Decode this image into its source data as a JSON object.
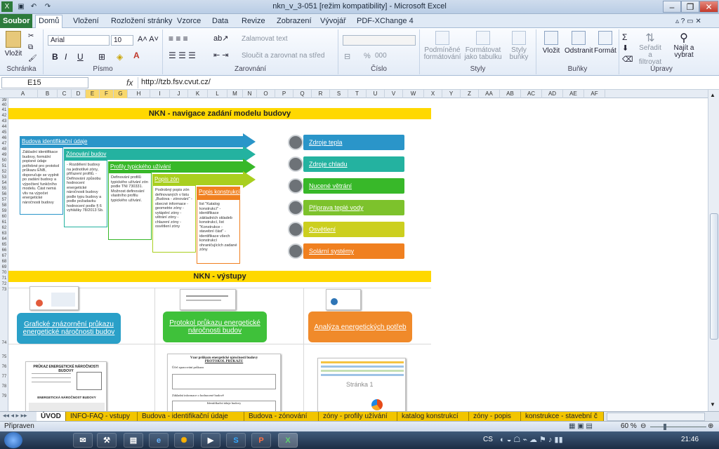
{
  "window": {
    "title": "nkn_v_3-051  [režim kompatibility]  -  Microsoft Excel"
  },
  "ribbon_tabs": [
    "Soubor",
    "Domů",
    "Vložení",
    "Rozložení stránky",
    "Vzorce",
    "Data",
    "Revize",
    "Zobrazení",
    "Vývojář",
    "PDF-XChange 4"
  ],
  "ribbon": {
    "clipboard": {
      "paste": "Vložit",
      "label": "Schránka"
    },
    "font": {
      "name": "Arial",
      "size": "10",
      "bold": "B",
      "italic": "I",
      "underline": "U",
      "label": "Písmo"
    },
    "alignment": {
      "wrap": "Zalamovat text",
      "merge": "Sloučit a zarovnat na střed",
      "label": "Zarovnání"
    },
    "number": {
      "percent": "%",
      "thousands": "000",
      "label": "Číslo"
    },
    "styles": {
      "conditional": "Podmíněné formátování",
      "table": "Formátovat jako tabulku",
      "cell_styles": "Styly buňky",
      "label": "Styly"
    },
    "cells": {
      "insert": "Vložit",
      "delete": "Odstranit",
      "format": "Formát",
      "label": "Buňky"
    },
    "editing": {
      "sort": "Seřadit a filtrovat",
      "find": "Najít a vybrat",
      "label": "Úpravy"
    }
  },
  "namebox": "E15",
  "fx": "fx",
  "formula": "http://tzb.fsv.cvut.cz/",
  "columns": [
    "A",
    "B",
    "C",
    "D",
    "E",
    "F",
    "G",
    "H",
    "I",
    "J",
    "K",
    "L",
    "M",
    "N",
    "O",
    "P",
    "Q",
    "R",
    "S",
    "T",
    "U",
    "V",
    "W",
    "X",
    "Y",
    "Z",
    "AA",
    "AB",
    "AC",
    "AD",
    "AE",
    "AF"
  ],
  "rows": [
    "39",
    "40",
    "41",
    "42",
    "43",
    "44",
    "45",
    "46",
    "47",
    "48",
    "49",
    "50",
    "51",
    "52",
    "53",
    "54",
    "55",
    "56",
    "57",
    "58",
    "59",
    "60",
    "61",
    "62",
    "63",
    "64",
    "65",
    "66",
    "67",
    "68",
    "69",
    "70",
    "71",
    "72",
    "73",
    "74",
    "75",
    "76",
    "77",
    "78",
    "79"
  ],
  "sheet": {
    "band1": "NKN - navigace zadání modelu budovy",
    "band2": "NKN - výstupy",
    "steps": [
      {
        "label": "Budova identifikační údaje",
        "color": "#2a95c9",
        "desc": "Základní identifikace budovy, formální popisné údaje potřebné pro protokol průkazu ENB, doporučuje se vyplnit po zadání budovy a výpočtení funkčního modelu. Část nemá vliv na výpočet energetické náročnosti budovy"
      },
      {
        "label": "Zónování budov",
        "color": "#24b2a0",
        "desc": "- Rozdělení budovy na jednotlivé zóny, přiřazení profilů. - Definování způsobu hodnocení energetické náročnosti budovy podle typu budovy a podle požadavku hodnocení podle § 6 vyhlášky 78/2013 Sb."
      },
      {
        "label": "Profily typického užívání",
        "color": "#38b829",
        "desc": "Definování profilů typického užívání zón podle TNI 730331. Možnost definování vlastního profilu typického užívání."
      },
      {
        "label": "Popis zón",
        "color": "#a9cf1f",
        "desc": "Podrobný popis zón definovaných v listu „Budova - zónování“ - obecné informace - geometrie zóny - vytápění zóny - větrání zóny - chlazení zóny - osvětlení zóny"
      },
      {
        "label": "Popis konstrukcí",
        "color": "#f08020",
        "desc": "list \"Katalog konstrukcí\" - identifikace základních skladeb konstrukcí, list \"Konstrukce - stavební část\" - identifikace všech konstrukcí ohraničujících zadané zóny"
      }
    ],
    "nav_buttons": [
      {
        "label": "Zdroje tepla",
        "color": "#2a95c9",
        "icon": "thermometer-icon"
      },
      {
        "label": "Zdroje chladu",
        "color": "#24b2a0",
        "icon": "cold-thermometer-icon"
      },
      {
        "label": "Nucené větrání",
        "color": "#38b829",
        "icon": "fan-icon"
      },
      {
        "label": "Příprava teplé vody",
        "color": "#7dc22c",
        "icon": "tap-icon"
      },
      {
        "label": "Osvětlení",
        "color": "#cccf1f",
        "icon": "bulb-icon"
      },
      {
        "label": "Solární systémy",
        "color": "#f08020",
        "icon": "sun-icon"
      }
    ],
    "outputs": [
      {
        "label": "Grafické znázornění průkazu energetické náročnosti budov",
        "color": "#2aa0c8"
      },
      {
        "label": "Protokol průkazu energetické náročnosti budov",
        "color": "#3fc13a"
      },
      {
        "label": "Analýza energetických potřeb",
        "color": "#f08a2a"
      }
    ],
    "thumb_texts": {
      "pruk_title": "PRŮKAZ ENERGETICKÉ NÁROČNOSTI BUDOVY",
      "pruk_sub": "ENERGETICKÁ NÁROČNOST BUDOVY",
      "proto_title": "Vzor průkazu energetické náročnosti budovy",
      "proto_sub": "PROTOKOL PRŮKAZU",
      "proto_sec": "Účel zpracování průkazu",
      "proto_sec2": "Základní informace o hodnocené budově",
      "proto_sec3": "Identifikační údaje budovy",
      "stranka": "Stránka 1"
    }
  },
  "sheet_tabs": [
    "ÚVOD",
    "INFO-FAQ - vstupy",
    "Budova - identifikační údaje",
    "Budova - zónování",
    "zóny - profily užívání",
    "katalog konstrukcí",
    "zóny - popis",
    "konstrukce - stavební č"
  ],
  "status": {
    "ready": "Připraven",
    "zoom": "60 %"
  },
  "taskbar": {
    "lang": "CS",
    "time": "21:46"
  }
}
